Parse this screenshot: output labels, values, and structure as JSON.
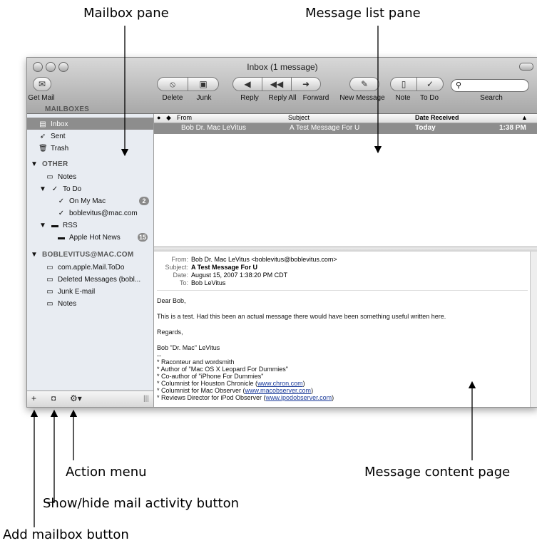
{
  "callouts": {
    "mailbox_pane": "Mailbox pane",
    "message_list_pane": "Message list pane",
    "action_menu": "Action menu",
    "message_content_page": "Message content page",
    "show_hide_activity": "Show/hide mail activity button",
    "add_mailbox": "Add mailbox button"
  },
  "window": {
    "title": "Inbox (1 message)"
  },
  "toolbar": {
    "get_mail": "Get Mail",
    "delete": "Delete",
    "junk": "Junk",
    "reply": "Reply",
    "reply_all": "Reply All",
    "forward": "Forward",
    "new_message": "New Message",
    "note": "Note",
    "to_do": "To Do",
    "search": "Search"
  },
  "sidebar": {
    "mailboxes_heading": "MAILBOXES",
    "inbox": "Inbox",
    "sent": "Sent",
    "trash": "Trash",
    "other_heading": "OTHER",
    "notes": "Notes",
    "to_do": "To Do",
    "on_my_mac": "On My Mac",
    "on_my_mac_count": "2",
    "boblevitus_mac": "boblevitus@mac.com",
    "rss": "RSS",
    "apple_hot_news": "Apple Hot News",
    "apple_hot_news_count": "15",
    "account_heading": "BOBLEVITUS@MAC.COM",
    "acct_todo": "com.apple.Mail.ToDo",
    "acct_deleted": "Deleted Messages (bobl...",
    "acct_junk": "Junk E-mail",
    "acct_notes": "Notes"
  },
  "list": {
    "col_from": "From",
    "col_subject": "Subject",
    "col_date": "Date Received",
    "rows": [
      {
        "from": "Bob Dr. Mac LeVitus",
        "subject": "A Test Message For U",
        "date": "Today",
        "time": "1:38 PM"
      }
    ]
  },
  "message": {
    "from_label": "From:",
    "from": "Bob Dr. Mac LeVitus <boblevitus@boblevitus.com>",
    "subject_label": "Subject:",
    "subject": "A Test Message For U",
    "date_label": "Date:",
    "date": "August 15, 2007 1:38:20 PM CDT",
    "to_label": "To:",
    "to": "Bob LeVitus",
    "greeting": "Dear Bob,",
    "body": "This is a test. Had this been an actual message there would have been something useful written here.",
    "regards": "Regards,",
    "sig_name": "Bob \"Dr. Mac\" LeVitus",
    "sig_sep": "--",
    "sig1": "* Raconteur and wordsmith",
    "sig2": "* Author of \"Mac OS X Leopard For Dummies\"",
    "sig3": "* Co-author of \"iPhone For Dummies\"",
    "sig4_pre": "* Columnist for Houston Chronicle (",
    "sig4_link": "www.chron.com",
    "sig4_post": ")",
    "sig5_pre": "* Columnist for Mac Observer (",
    "sig5_link": "www.macobserver.com",
    "sig5_post": ")",
    "sig6_pre": "* Reviews Director for iPod Observer (",
    "sig6_link": "www.ipodobserver.com",
    "sig6_post": ")"
  }
}
